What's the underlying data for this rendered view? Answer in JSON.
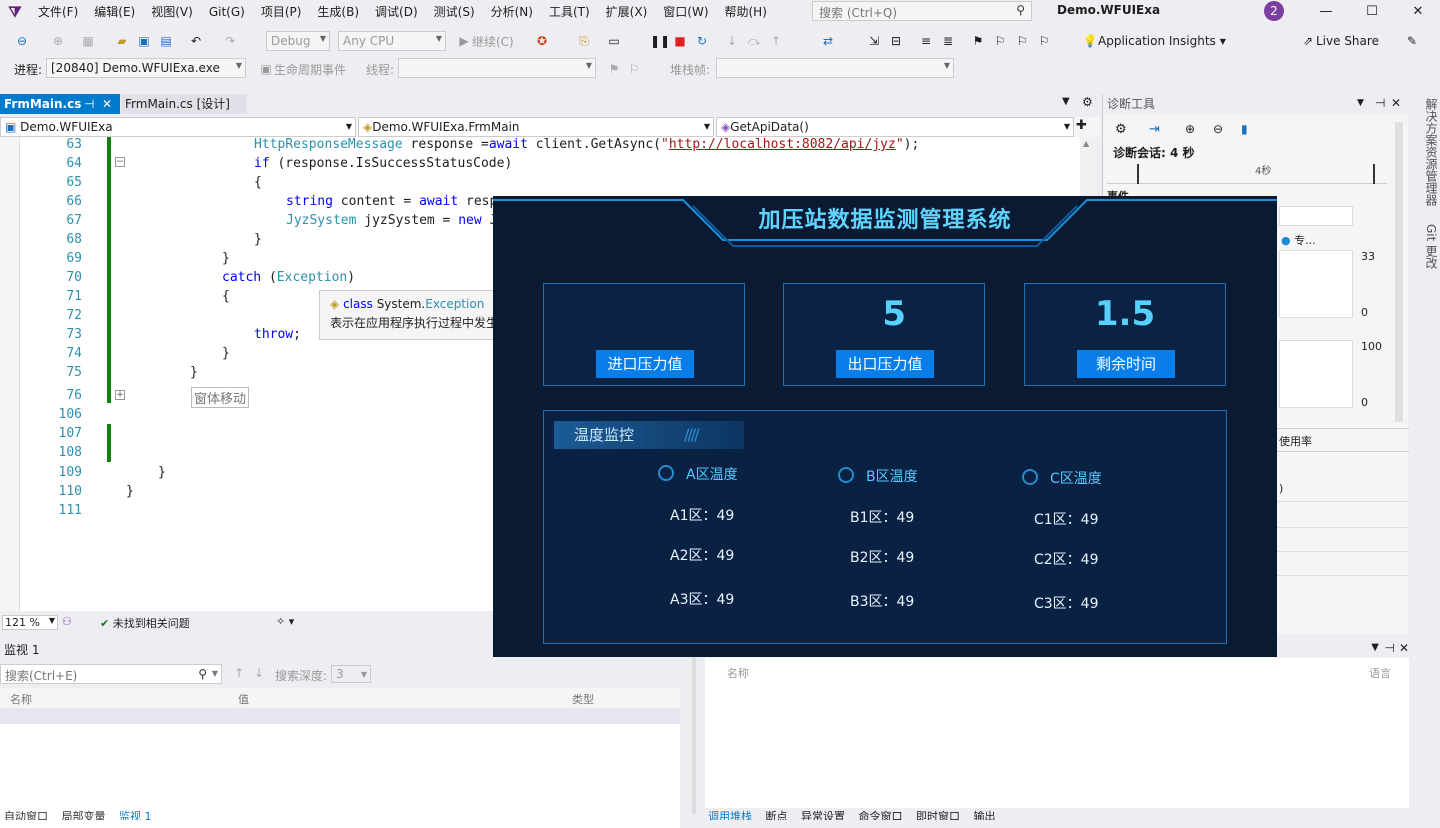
{
  "menu": {
    "items": [
      "文件(F)",
      "编辑(E)",
      "视图(V)",
      "Git(G)",
      "项目(P)",
      "生成(B)",
      "调试(D)",
      "测试(S)",
      "分析(N)",
      "工具(T)",
      "扩展(X)",
      "窗口(W)",
      "帮助(H)"
    ],
    "search_placeholder": "搜索 (Ctrl+Q)",
    "app_title": "Demo.WFUIExa",
    "avatar_badge": "2"
  },
  "toolbar": {
    "config": "Debug",
    "platform": "Any CPU",
    "continue_label": "继续(C)",
    "insights_label": "Application Insights",
    "live_share_label": "Live Share",
    "process_label": "进程:",
    "process_value": "[20840] Demo.WFUIExa.exe",
    "lifecycle_label": "生命周期事件",
    "thread_label": "线程:",
    "stackframe_label": "堆栈帧:"
  },
  "tabs": [
    {
      "label": "FrmMain.cs"
    },
    {
      "label": "FrmMain.cs [设计]"
    }
  ],
  "nav": {
    "project": "Demo.WFUIExa",
    "class": "Demo.WFUIExa.FrmMain",
    "member": "GetApiData()"
  },
  "code_lines": [
    {
      "n": "63",
      "text": "HttpResponseMessage response =await client.GetAsync(\"http://localhost:8082/api/jyz\");"
    },
    {
      "n": "64",
      "text": "if (response.IsSuccessStatusCode)"
    },
    {
      "n": "65",
      "text": "{"
    },
    {
      "n": "66",
      "text": "string content = await resp"
    },
    {
      "n": "67",
      "text": "JyzSystem jyzSystem = new J"
    },
    {
      "n": "68",
      "text": "}"
    },
    {
      "n": "69",
      "text": "}"
    },
    {
      "n": "70",
      "text": "catch (Exception)"
    },
    {
      "n": "71",
      "text": "{"
    },
    {
      "n": "72",
      "text": ""
    },
    {
      "n": "73",
      "text": "throw;"
    },
    {
      "n": "74",
      "text": "}"
    },
    {
      "n": "75",
      "text": "}"
    },
    {
      "n": "76",
      "text": "窗体移动"
    },
    {
      "n": "106",
      "text": ""
    },
    {
      "n": "107",
      "text": ""
    },
    {
      "n": "108",
      "text": ""
    },
    {
      "n": "109",
      "text": "}"
    },
    {
      "n": "110",
      "text": "}"
    },
    {
      "n": "111",
      "text": ""
    }
  ],
  "tooltip": {
    "kind": "class",
    "ns": "System.",
    "type": "Exception",
    "desc": "表示在应用程序执行过程中发生的错误。 若要浏览此类型的 .NET Framework 源代码，请参阅引用源。"
  },
  "status": {
    "zoom": "121 %",
    "issues": "未找到相关问题"
  },
  "watch": {
    "title": "监视 1",
    "search_placeholder": "搜索(Ctrl+E)",
    "depth_label": "搜索深度:",
    "depth_value": "3",
    "columns": [
      "名称",
      "值",
      "类型"
    ],
    "tabs": [
      "自动窗口",
      "局部变量",
      "监视 1"
    ]
  },
  "callstack": {
    "columns": [
      "名称",
      "语言"
    ],
    "tabs": [
      "调用堆栈",
      "断点",
      "异常设置",
      "命令窗口",
      "即时窗口",
      "输出"
    ]
  },
  "diagnostics": {
    "title": "诊断工具",
    "session": "诊断会话: 4 秒",
    "tick": "4秒",
    "events_label": "事件",
    "pro_label": "专...",
    "axis1_top": "33",
    "axis1_bottom": "0",
    "axis2_top": "100",
    "axis2_bottom": "0",
    "usage_label": "使用率",
    "paren": ")"
  },
  "side_tabs": [
    "解决方案资源管理器",
    "Git 更改"
  ],
  "app": {
    "title": "加压站数据监测管理系统",
    "cards": [
      {
        "value": "",
        "label": "进口压力值"
      },
      {
        "value": "5",
        "label": "出口压力值"
      },
      {
        "value": "1.5",
        "label": "剩余时间"
      }
    ],
    "temp_title": "温度监控",
    "zones": [
      {
        "label": "A区温度",
        "rows": [
          "A1区：49",
          "A2区：49",
          "A3区：49"
        ]
      },
      {
        "label": "B区温度",
        "rows": [
          "B1区：49",
          "B2区：49",
          "B3区：49"
        ]
      },
      {
        "label": "C区温度",
        "rows": [
          "C1区：49",
          "C2区：49",
          "C3区：49"
        ]
      }
    ]
  },
  "colors": {
    "accent": "#007acc",
    "app_bg": "#0b1a33",
    "app_cyan": "#56d0ff",
    "app_button": "#0a7ee8",
    "changed_bar": "#108010"
  }
}
